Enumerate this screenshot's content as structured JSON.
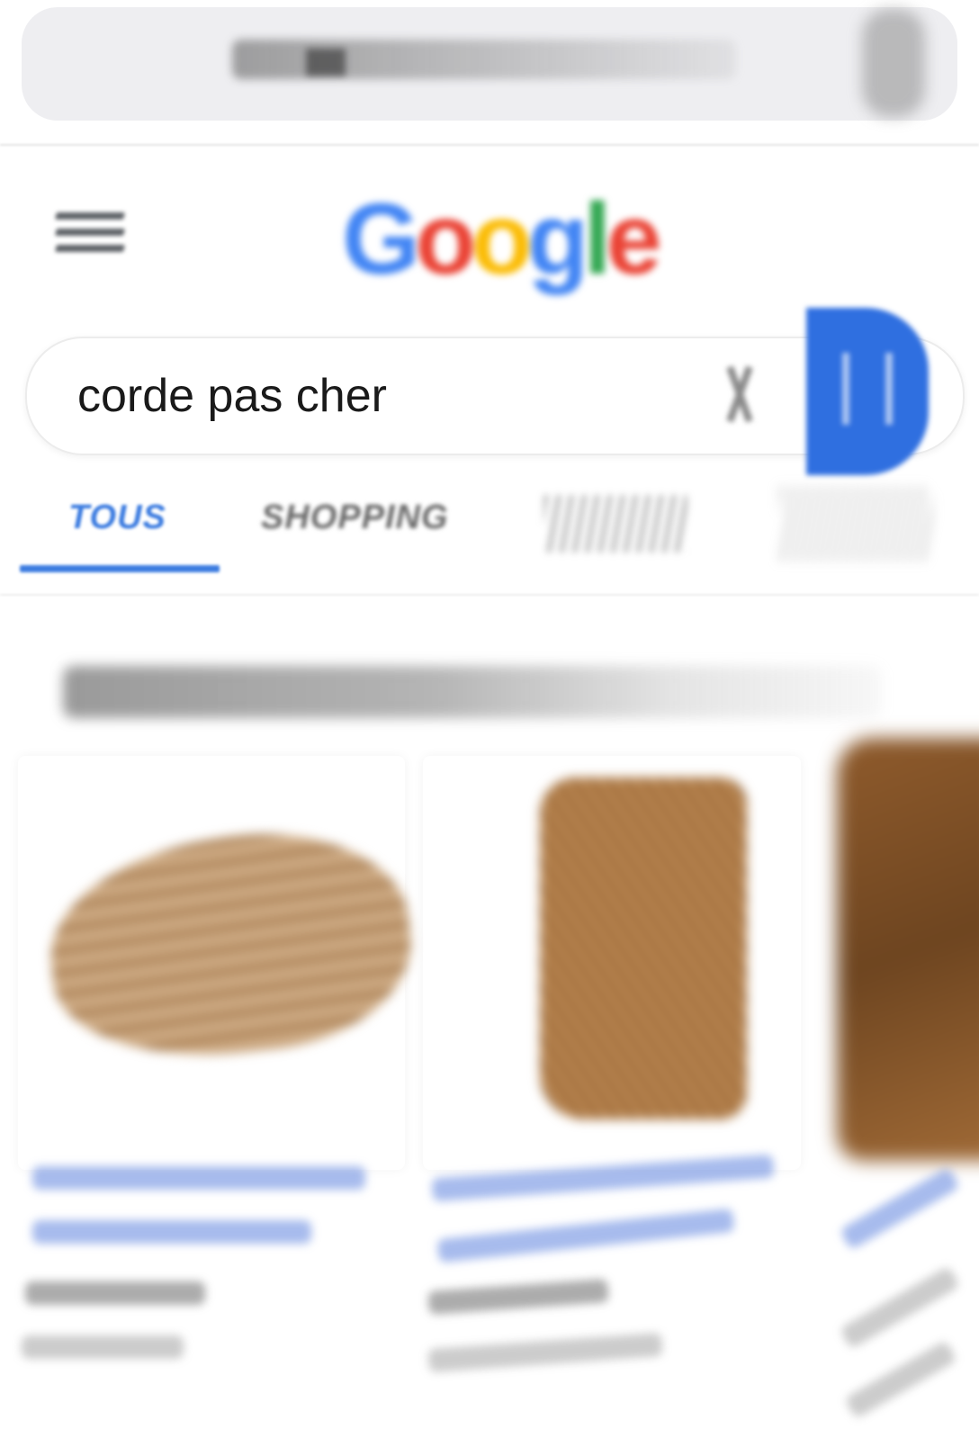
{
  "search": {
    "query": "corde pas cher"
  },
  "tabs": [
    {
      "label": "TOUS"
    },
    {
      "label": "SHOPPING"
    }
  ],
  "colors": {
    "accent": "#3c7ce0",
    "search_button": "#2f6fe0",
    "logo": [
      "#4285f4",
      "#ea4335",
      "#fbbc05",
      "#4285f4",
      "#34a853",
      "#ea4335"
    ]
  },
  "icons": {
    "menu": "hamburger-menu-icon",
    "clear": "clear-icon",
    "search": "search-icon"
  }
}
